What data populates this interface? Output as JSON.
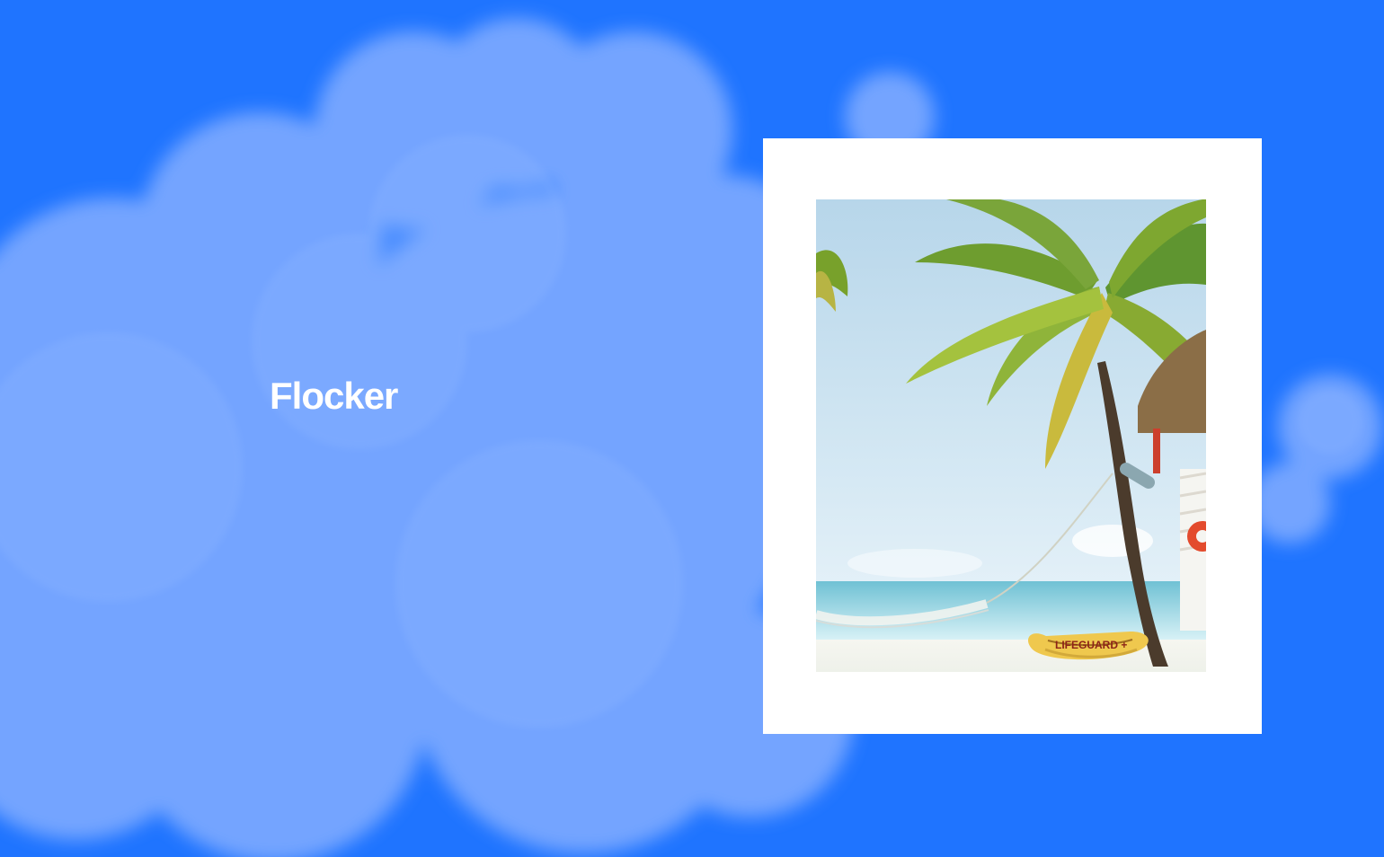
{
  "brand": {
    "name": "Flocker"
  },
  "hero": {
    "image_subject": "tropical beach with palm tree, hammock and lifeguard rescue board",
    "board_text": "LIFEGUARD +"
  },
  "colors": {
    "background": "#1f74ff",
    "cloud": "#6ea2ff",
    "frame": "#ffffff"
  },
  "icons": {
    "cloud": "cloud-icon",
    "palm": "palm-tree-icon",
    "board": "rescue-board-icon"
  }
}
